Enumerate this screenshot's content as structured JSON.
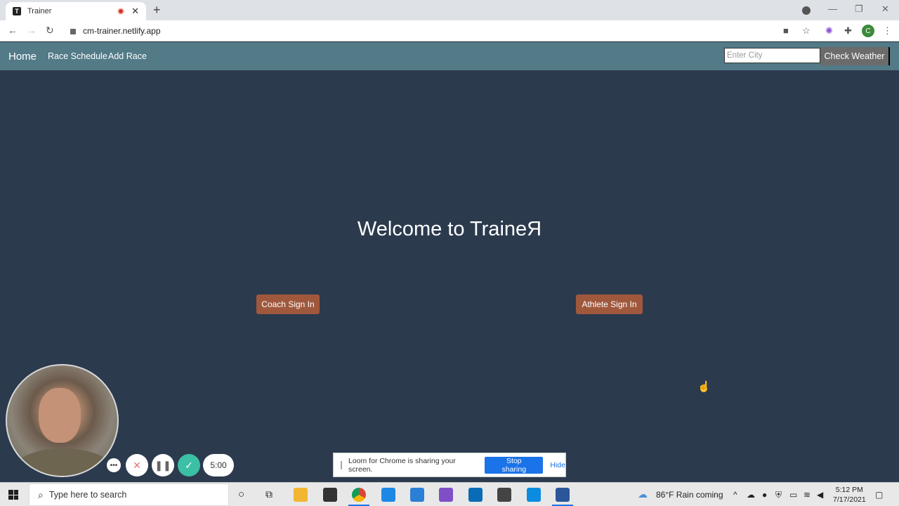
{
  "browser": {
    "tab_title": "Trainer",
    "tab_favicon_letter": "T",
    "url": "cm-trainer.netlify.app",
    "profile_initial": "C"
  },
  "navbar": {
    "brand": "Home",
    "links": [
      "Race Schedule",
      "Add Race"
    ],
    "city_placeholder": "Enter City",
    "weather_button": "Check Weather"
  },
  "main": {
    "welcome": "Welcome to TraineЯ",
    "coach_button": "Coach Sign In",
    "athlete_button": "Athlete Sign In"
  },
  "loom": {
    "timer": "5:00",
    "share_message": "Loom for Chrome is sharing your screen.",
    "stop_button": "Stop sharing",
    "hide_button": "Hide"
  },
  "taskbar": {
    "search_placeholder": "Type here to search",
    "weather": "86°F  Rain coming",
    "time": "5:12 PM",
    "date": "7/17/2021"
  },
  "colors": {
    "page_bg": "#2c3a4e",
    "navbar_bg": "#527a87",
    "signin_button": "#a0583c",
    "weather_button": "#6b6b6b",
    "accent_blue": "#1a73e8"
  }
}
